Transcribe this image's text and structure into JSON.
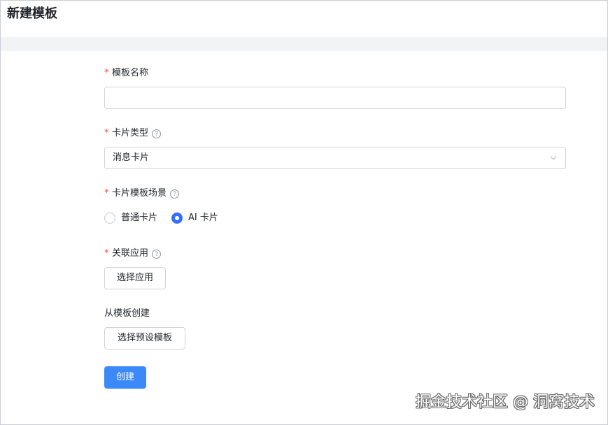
{
  "header": {
    "title": "新建模板"
  },
  "form": {
    "required_mark": "*",
    "help_glyph": "?",
    "template_name": {
      "label": "模板名称",
      "value": "",
      "placeholder": ""
    },
    "card_type": {
      "label": "卡片类型",
      "selected": "消息卡片",
      "icon": "chevron-down-icon"
    },
    "scene": {
      "label": "卡片模板场景",
      "options": [
        {
          "label": "普通卡片",
          "checked": false
        },
        {
          "label": "AI 卡片",
          "checked": true
        }
      ]
    },
    "app": {
      "label": "关联应用",
      "button": "选择应用"
    },
    "from_template": {
      "label": "从模板创建",
      "button": "选择预设模板"
    },
    "submit_label": "创建"
  },
  "watermark": "掘金技术社区 @ 洞窝技术",
  "colors": {
    "primary": "#3c8af8",
    "radio_checked": "#3370ff",
    "required": "#f54a45",
    "border": "#d0d3d6",
    "band": "#f2f3f5"
  }
}
